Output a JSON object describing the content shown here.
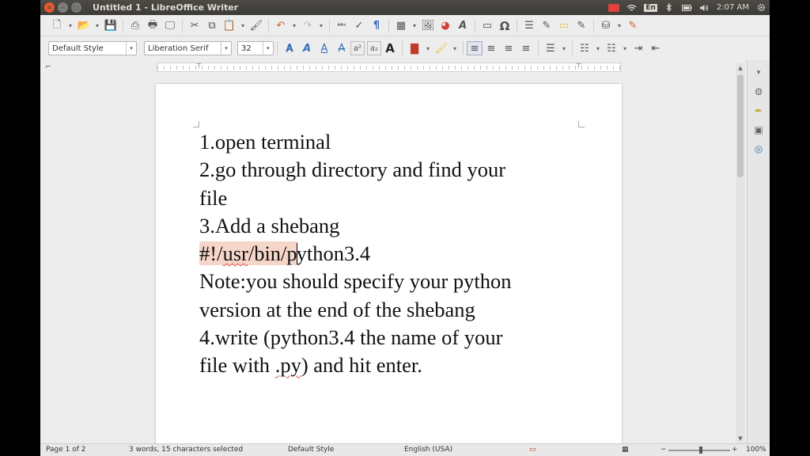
{
  "window": {
    "title": "Untitled 1 - LibreOffice Writer",
    "close_glyph": "×",
    "min_glyph": "–",
    "max_glyph": "□"
  },
  "tray": {
    "language": "En",
    "clock": "2:07 AM"
  },
  "formatting": {
    "paragraph_style": "Default Style",
    "font_name": "Liberation Serif",
    "font_size": "32"
  },
  "document": {
    "paragraphs": [
      {
        "text": "1.open terminal"
      },
      {
        "text": "2.go through directory and find your"
      },
      {
        "text": "file"
      },
      {
        "text": "3.Add a shebang"
      },
      {
        "shebang_sel_a": "#!/",
        "shebang_sel_b": "usr",
        "shebang_sel_c": "/bin/p",
        "shebang_rest": "ython3.4"
      },
      {
        "text": "Note:you should specify your python"
      },
      {
        "text": "version at the end of the shebang"
      },
      {
        "text": "4.write (python3.4 the name of your"
      },
      {
        "line_start": "file with ",
        "py_ext": ".py",
        "line_end": ") and hit enter."
      }
    ]
  },
  "statusbar": {
    "page": "Page 1 of 2",
    "selection": "3 words, 15 characters selected",
    "style": "Default Style",
    "language": "English (USA)",
    "zoom": "100%"
  },
  "icons": {
    "new": "🗋",
    "open": "📂",
    "save": "💾",
    "pdf": "⎙",
    "print": "🖶",
    "preview": "🖵",
    "cut": "✂",
    "copy": "⧉",
    "paste": "📋",
    "clone": "🖌",
    "undo": "↶",
    "redo": "↷",
    "spell": "ᴬᴮᶜ",
    "autospell": "✓",
    "pilcrow": "¶",
    "table": "▦",
    "image": "🖼",
    "chart": "◕",
    "fontwork": "A",
    "textbox": "▭",
    "special": "Ω",
    "navigator": "☰",
    "shapes": "✎",
    "bold_a": "𝐀",
    "shadow_a": "A",
    "outline_a": "A",
    "strike_a": "A",
    "super": "a²",
    "sub": "a₂",
    "fontcolor": "A",
    "highlight": "▇",
    "paintbucket": "⛁",
    "align_left": "≡",
    "align_center": "≡",
    "align_right": "≡",
    "justify": "≡",
    "linespacing": "☰",
    "list_bullet": "☷",
    "list_num": "☷",
    "indent_inc": "⇥",
    "indent_dec": "⇤",
    "sb_properties": "⚙",
    "sb_styles": "✒",
    "sb_gallery": "▣",
    "sb_navigator": "◎",
    "arrow_down": "▾",
    "scroll_up": "▲",
    "scroll_down": "▼",
    "minus": "−",
    "plus": "+",
    "ruler_corner": "⌐",
    "tab_marker": "⊤"
  }
}
